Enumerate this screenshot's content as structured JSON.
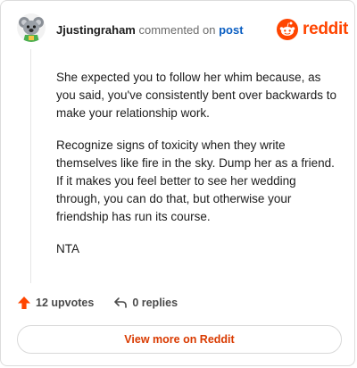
{
  "header": {
    "username": "Jjustingraham",
    "commented_text": "commented on",
    "post_link": "post",
    "logo_text": "reddit"
  },
  "comment": {
    "paragraphs": [
      "She expected you to follow her whim because, as you said, you've consistently bent over backwards to make your relationship work.",
      "Recognize signs of toxicity when they write themselves like fire in the sky. Dump her as a friend. If it makes you feel better to see her wedding through, you can do that, but otherwise your friendship has run its course.",
      "NTA"
    ]
  },
  "stats": {
    "upvotes": "12 upvotes",
    "replies": "0 replies"
  },
  "footer": {
    "view_more_label": "View more on Reddit"
  },
  "colors": {
    "brand": "#ff4500",
    "link": "#0a5ec2",
    "button_text": "#d93a00"
  },
  "icons": {
    "avatar": "koala-avatar-icon",
    "logo": "reddit-snoo-icon",
    "upvote": "upvote-arrow-icon",
    "reply": "reply-arrow-icon"
  }
}
